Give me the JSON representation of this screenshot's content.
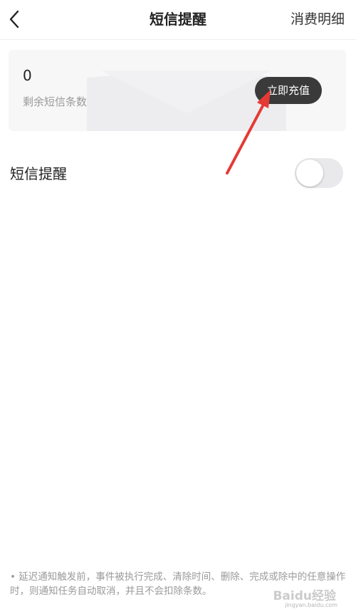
{
  "nav": {
    "title": "短信提醒",
    "right_link": "消费明细"
  },
  "balance": {
    "value": "0",
    "label": "剩余短信条数",
    "recharge_label": "立即充值"
  },
  "setting": {
    "label": "短信提醒",
    "enabled": false
  },
  "footnote": {
    "text": "• 延迟通知触发前，事件被执行完成、清除时间、删除、完成或除中的任意操作时，则通知任务自动取消，并且不会扣除条数。"
  },
  "watermark": {
    "text": "Baidu经验",
    "sub": "jingyan.baidu.com"
  },
  "colors": {
    "annotation_arrow": "#e53935",
    "button_bg": "#3a3a3a",
    "card_bg": "#f7f7f8"
  }
}
